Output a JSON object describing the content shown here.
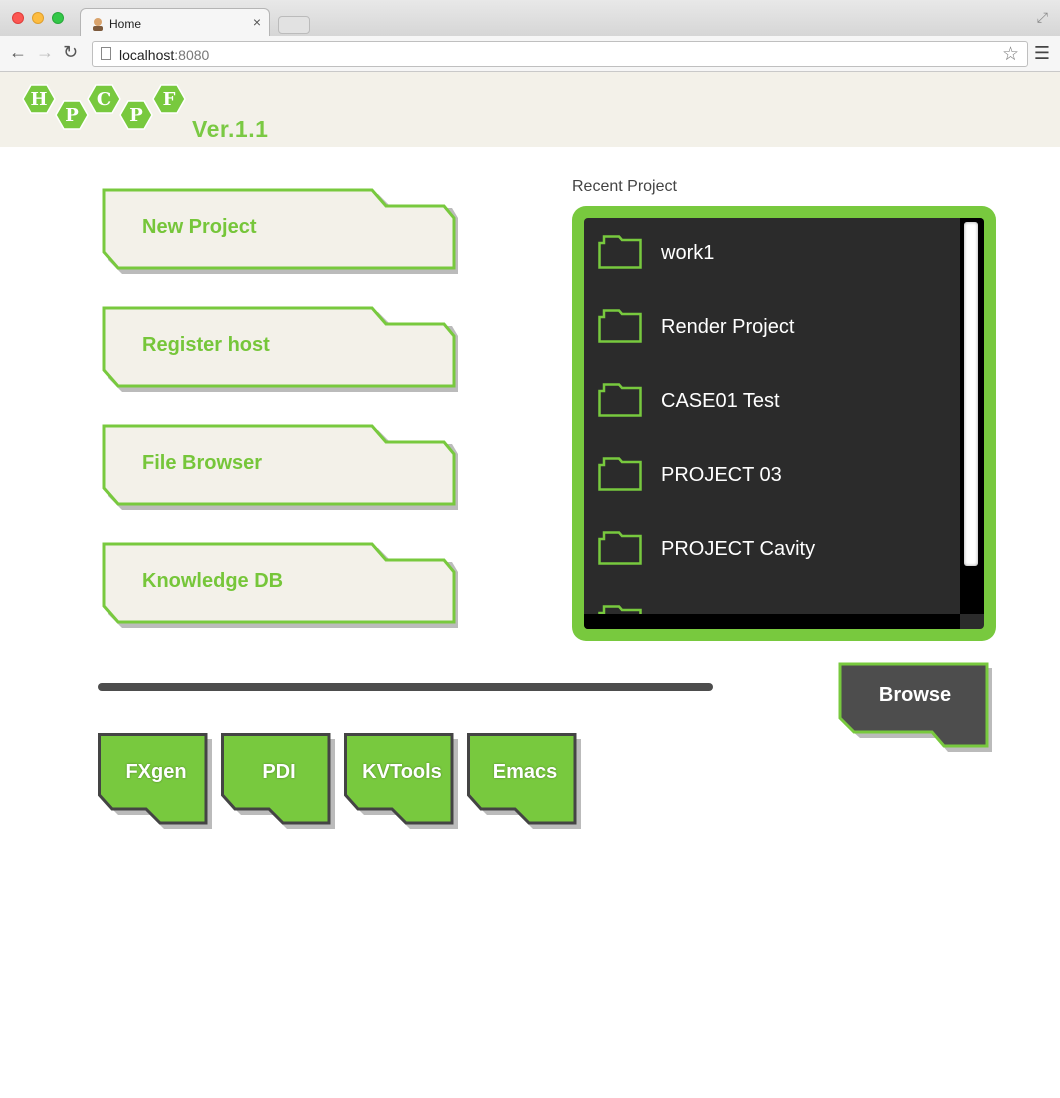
{
  "browser": {
    "tab_title": "Home",
    "tab_close": "×",
    "url_host": "localhost",
    "url_port": ":8080"
  },
  "app": {
    "logo_letters": [
      "H",
      "P",
      "C",
      "P",
      "F"
    ],
    "version": "Ver.1.1"
  },
  "menu": {
    "items": [
      {
        "label": "New Project"
      },
      {
        "label": "Register host"
      },
      {
        "label": "File Browser"
      },
      {
        "label": "Knowledge DB"
      }
    ]
  },
  "recent": {
    "title": "Recent Project",
    "projects": [
      {
        "name": "work1"
      },
      {
        "name": "Render Project"
      },
      {
        "name": "CASE01 Test"
      },
      {
        "name": "PROJECT 03"
      },
      {
        "name": "PROJECT Cavity"
      },
      {
        "name": ""
      }
    ],
    "browse_label": "Browse"
  },
  "tools": {
    "items": [
      {
        "label": "FXgen"
      },
      {
        "label": "PDI"
      },
      {
        "label": "KVTools"
      },
      {
        "label": "Emacs"
      }
    ]
  },
  "colors": {
    "accent_green": "#78c93e",
    "text_green": "#76c63a",
    "dark_panel": "#2b2b2b",
    "header_bg": "#f3f1e9"
  }
}
